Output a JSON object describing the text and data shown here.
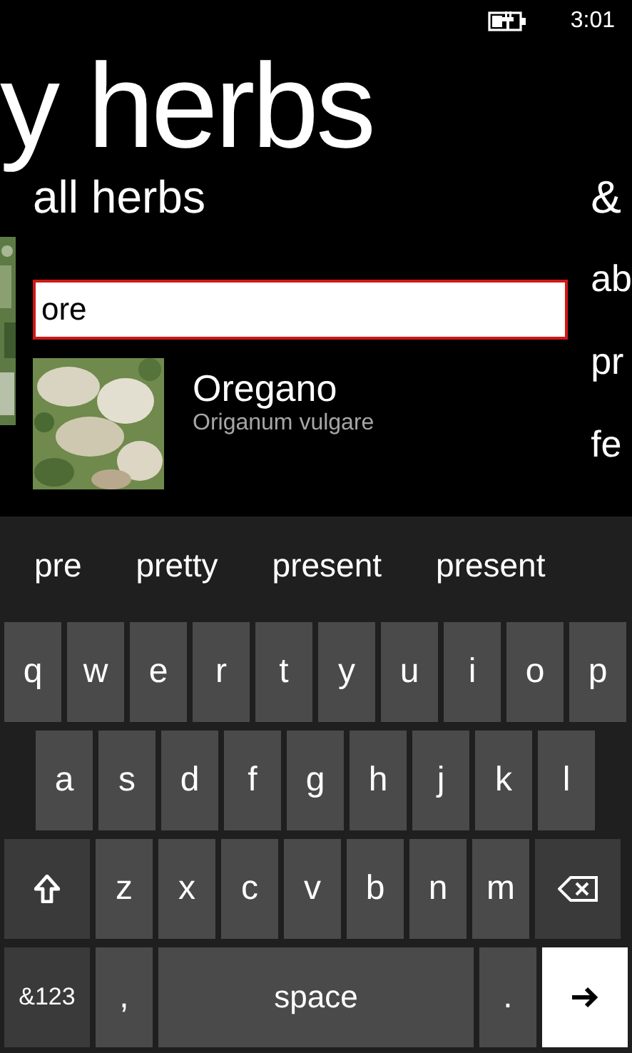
{
  "status_bar": {
    "time": "3:01"
  },
  "app_title": "y herbs",
  "pivot_headers": [
    "all herbs",
    "&"
  ],
  "search": {
    "value": "ore"
  },
  "results": [
    {
      "name": "Oregano",
      "latin": "Origanum vulgare"
    }
  ],
  "side_items": [
    "ab",
    "pr",
    "fe"
  ],
  "keyboard": {
    "suggestions": [
      "pre",
      "pretty",
      "present",
      "present"
    ],
    "rows": [
      {
        "keys": [
          {
            "kind": "letter",
            "label": "q"
          },
          {
            "kind": "letter",
            "label": "w"
          },
          {
            "kind": "letter",
            "label": "e"
          },
          {
            "kind": "letter",
            "label": "r"
          },
          {
            "kind": "letter",
            "label": "t"
          },
          {
            "kind": "letter",
            "label": "y"
          },
          {
            "kind": "letter",
            "label": "u"
          },
          {
            "kind": "letter",
            "label": "i"
          },
          {
            "kind": "letter",
            "label": "o"
          },
          {
            "kind": "letter",
            "label": "p"
          }
        ]
      },
      {
        "keys": [
          {
            "kind": "letter",
            "label": "a"
          },
          {
            "kind": "letter",
            "label": "s"
          },
          {
            "kind": "letter",
            "label": "d"
          },
          {
            "kind": "letter",
            "label": "f"
          },
          {
            "kind": "letter",
            "label": "g"
          },
          {
            "kind": "letter",
            "label": "h"
          },
          {
            "kind": "letter",
            "label": "j"
          },
          {
            "kind": "letter",
            "label": "k"
          },
          {
            "kind": "letter",
            "label": "l"
          }
        ]
      },
      {
        "keys": [
          {
            "kind": "shift"
          },
          {
            "kind": "letter",
            "label": "z"
          },
          {
            "kind": "letter",
            "label": "x"
          },
          {
            "kind": "letter",
            "label": "c"
          },
          {
            "kind": "letter",
            "label": "v"
          },
          {
            "kind": "letter",
            "label": "b"
          },
          {
            "kind": "letter",
            "label": "n"
          },
          {
            "kind": "letter",
            "label": "m"
          },
          {
            "kind": "backspace"
          }
        ]
      },
      {
        "keys": [
          {
            "kind": "wide",
            "label": "&123"
          },
          {
            "kind": "letter",
            "label": ","
          },
          {
            "kind": "space",
            "label": "space"
          },
          {
            "kind": "letter",
            "label": "."
          },
          {
            "kind": "enter"
          }
        ]
      }
    ]
  }
}
